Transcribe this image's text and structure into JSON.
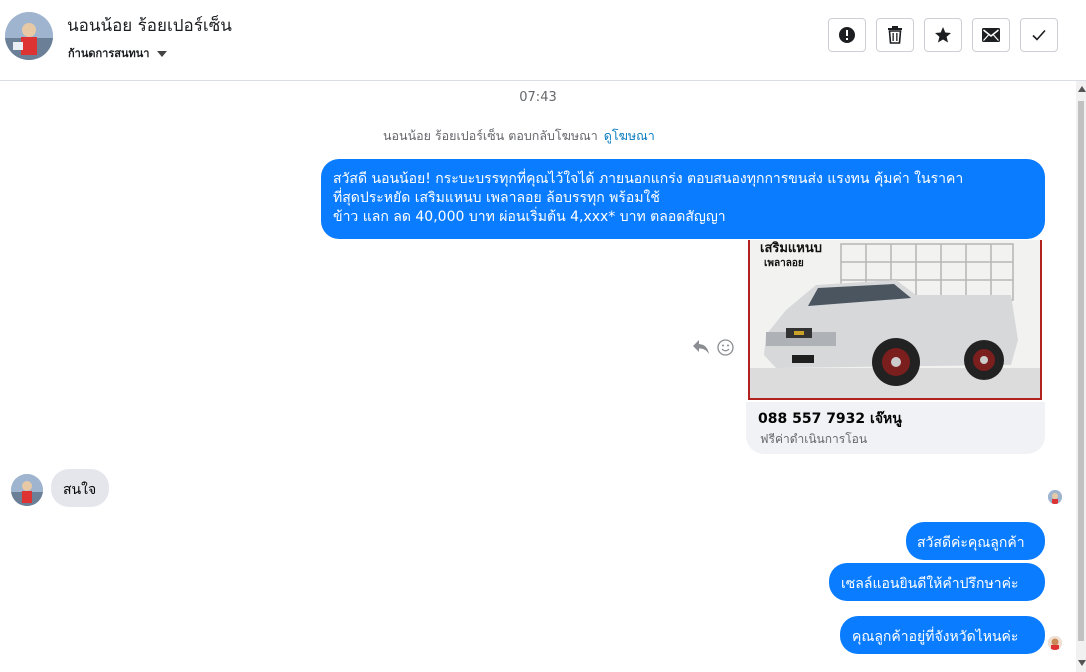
{
  "header": {
    "contact_name": "นอนน้อย ร้อยเปอร์เซ็น",
    "conversation_status": "ก้านดการสนทนา",
    "actions": [
      {
        "name": "report-button",
        "icon": "alert-circle-icon"
      },
      {
        "name": "delete-button",
        "icon": "trash-icon"
      },
      {
        "name": "star-button",
        "icon": "star-icon"
      },
      {
        "name": "mark-unread-button",
        "icon": "envelope-icon"
      },
      {
        "name": "done-button",
        "icon": "check-icon"
      }
    ]
  },
  "conversation": {
    "timestamp": "07:43",
    "ad_notice": {
      "text": "นอนน้อย ร้อยเปอร์เซ็น ตอบกลับโฆษณา",
      "link": "ดูโฆษณา"
    },
    "ad_message": {
      "lines": [
        "สวัสดี นอนน้อย! กระบะบรรทุกที่คุณไว้ใจได้ ภายนอกแกร่ง ตอบสนองทุกการขนส่ง แรงทน คุ้มค่า ในราคา",
        "ที่สุดประหยัด เสริมแหนบ เพลาลอย ล้อบรรทุก พร้อมใช้",
        "ข้าว แลก ลด 40,000 บาท ผ่อนเริ่มต้น 4,xxx* บาท ตลอดสัญญา"
      ]
    },
    "ad_card": {
      "image_caption_line1": "เสริมแหนบ",
      "image_caption_line2": "เพลาลอย",
      "title": "088 557 7932 เจ๊หนู",
      "subtitle": "ฟรีค่าดำเนินการโอน"
    },
    "incoming": [
      {
        "text": "สนใจ"
      }
    ],
    "outgoing": [
      {
        "text": "สวัสดีค่ะคุณลูกค้า"
      },
      {
        "text": "เซลล์แอนยินดีให้คำปรึกษาค่ะ"
      },
      {
        "text": "คุณลูกค้าอยู่ที่จังหวัดไหนค่ะ"
      }
    ]
  },
  "colors": {
    "outgoing_bubble": "#0a7cff",
    "incoming_bubble": "#e4e6eb",
    "link": "#0a7cc1"
  }
}
